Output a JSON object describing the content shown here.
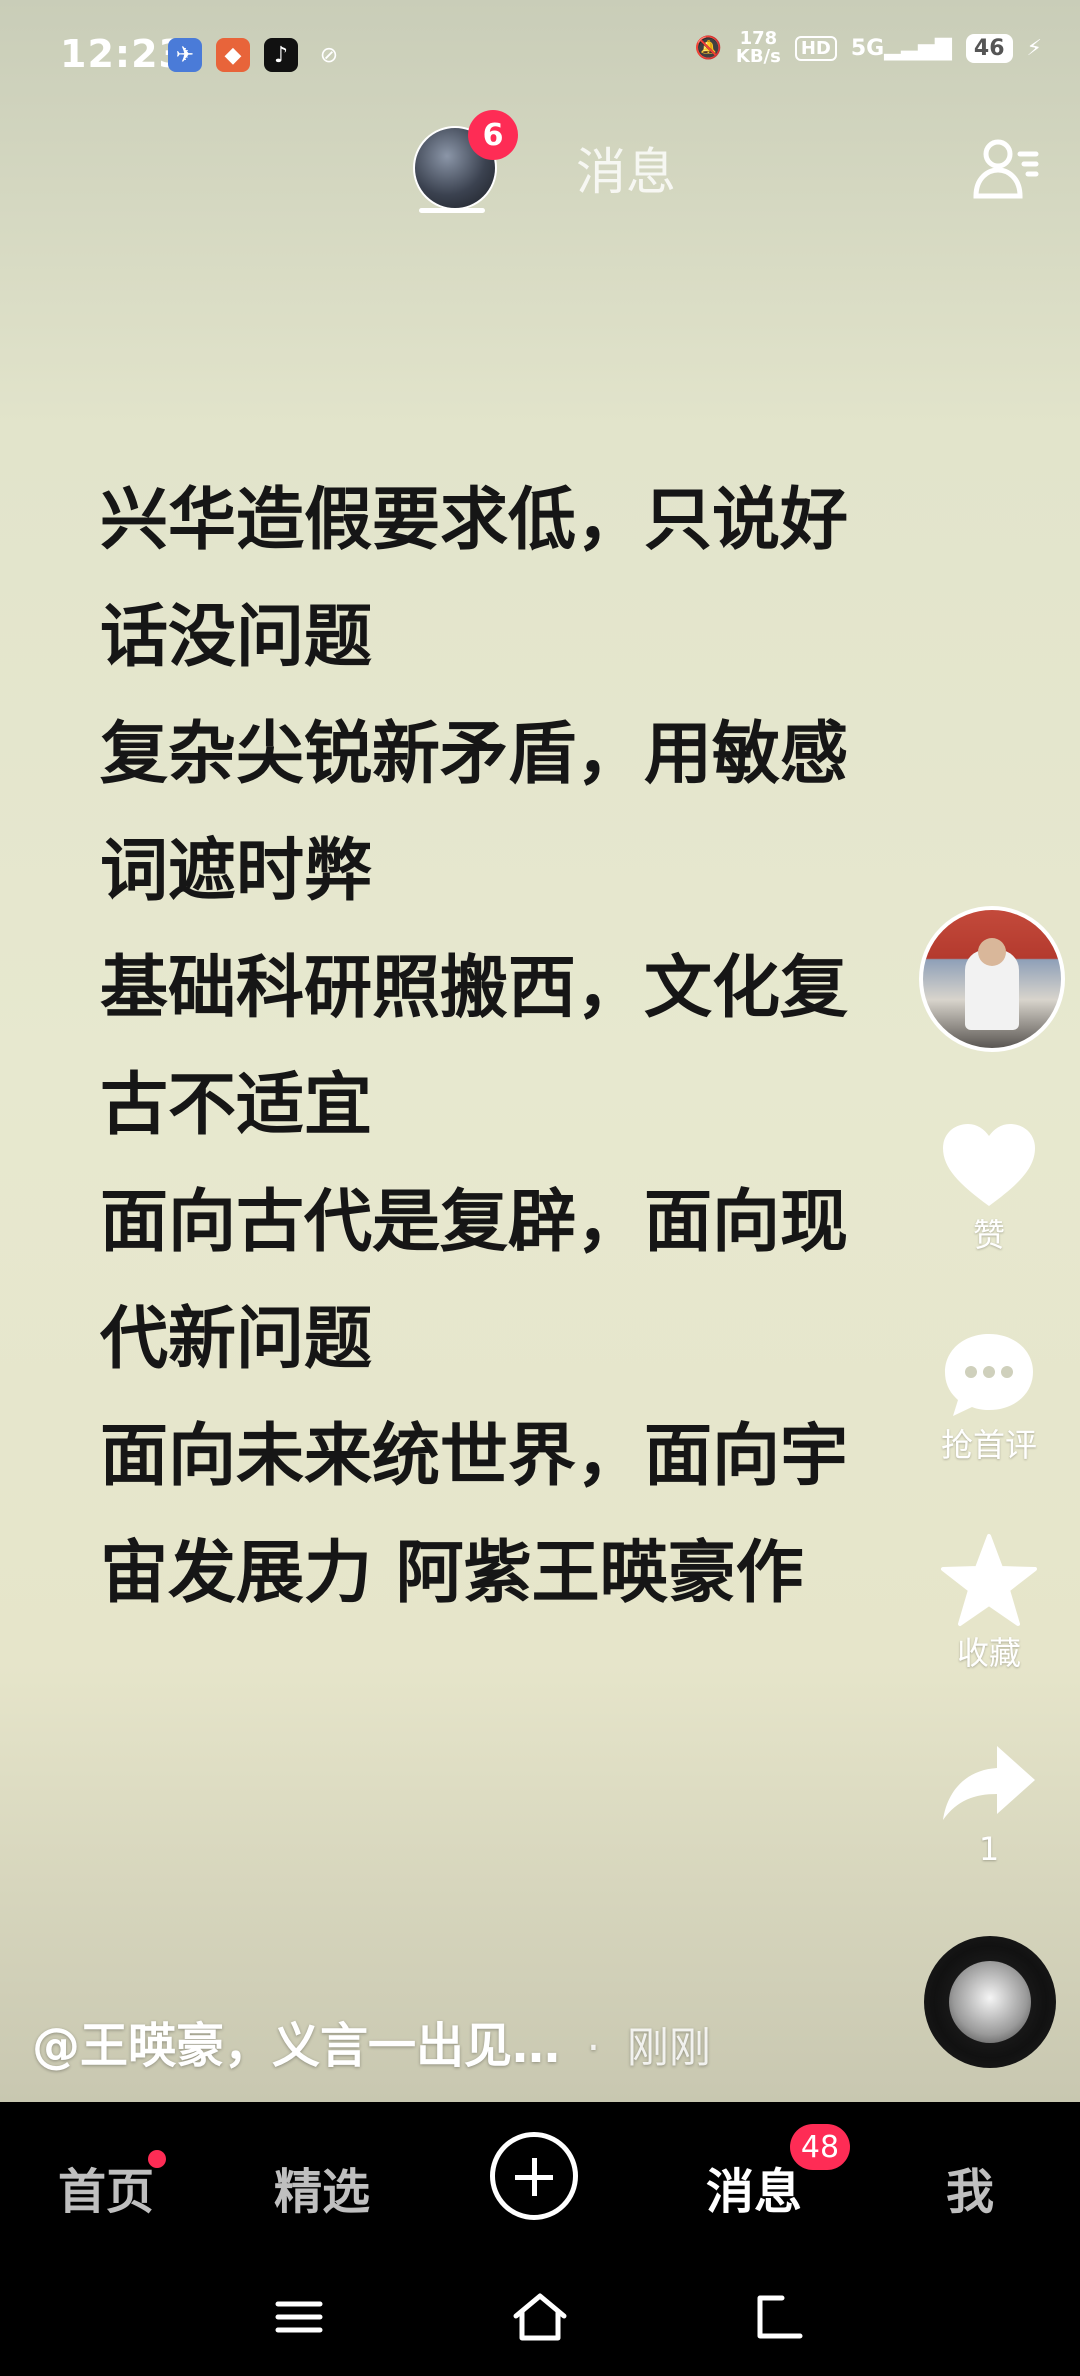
{
  "status_bar": {
    "time": "12:23",
    "net_speed_value": "178",
    "net_speed_unit": "KB/s",
    "hd": "HD",
    "network": "5G",
    "battery": "46"
  },
  "top_nav": {
    "avatar_badge": "6",
    "messages_tab": "消息"
  },
  "poem": {
    "lines": [
      "兴华造假要求低，只说好",
      "话没问题",
      "复杂尖锐新矛盾，用敏感",
      "词遮时弊",
      "基础科研照搬西，文化复",
      "古不适宜",
      "面向古代是复辟，面向现",
      "代新问题",
      "面向未来统世界，面向宇",
      "宙发展力  阿紫王暎豪作"
    ]
  },
  "actions": {
    "like_label": "赞",
    "comment_label": "抢首评",
    "favorite_label": "收藏",
    "share_count": "1"
  },
  "caption": {
    "text": "@王暎豪，义言一出见…",
    "separator": "·",
    "time": "刚刚"
  },
  "bottom_tabs": {
    "home": "首页",
    "featured": "精选",
    "messages": "消息",
    "messages_badge": "48",
    "me": "我"
  },
  "colors": {
    "accent": "#fe2c55",
    "tab_bar": "#000000",
    "poem_text": "#161616"
  }
}
